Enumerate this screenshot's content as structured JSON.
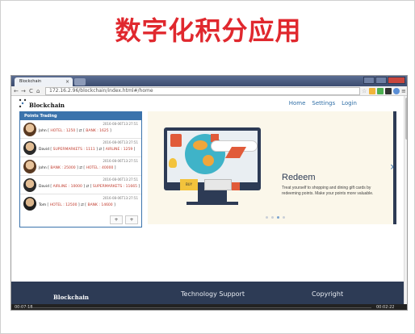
{
  "slide": {
    "title": "数字化积分应用"
  },
  "browser": {
    "tab_title": "Blockchain",
    "tab_close": "×",
    "url": "172.16.2.96/blockchain/index.html#/home",
    "nav": {
      "back": "←",
      "forward": "→",
      "reload": "C",
      "home": "⌂"
    },
    "star": "☆"
  },
  "site": {
    "brand": "Blockchain",
    "nav": [
      "Home",
      "Settings",
      "Login"
    ]
  },
  "points_trading": {
    "title": "Points Trading",
    "trades": [
      {
        "time": "2016-08-06T13:27:51",
        "user": "John",
        "from": "HOTEL : 1250",
        "to": "BANK : 1625"
      },
      {
        "time": "2016-08-06T13:27:51",
        "user": "David",
        "from": "SUPERMARKETS : 1111",
        "to": "AIRLINE : 1259"
      },
      {
        "time": "2016-08-06T13:27:51",
        "user": "John",
        "from": "BANK : 25000",
        "to": "HOTEL : 40000"
      },
      {
        "time": "2016-08-06T13:27:51",
        "user": "David",
        "from": "AIRLINE : 10000",
        "to": "SUPERMARKETS : 11665"
      },
      {
        "time": "2016-08-06T13:27:51",
        "user": "Tom",
        "from": "HOTEL : 12500",
        "to": "BANK : 14600"
      }
    ],
    "pager": [
      "+",
      "+"
    ]
  },
  "carousel": {
    "heading": "Redeem",
    "text": "Treat yourself to shopping and dining gift cards by redeeming points. Make your points more valuable.",
    "buy_label": "BUY",
    "next_arrow": "›",
    "active_slide": 3,
    "slide_count": 4
  },
  "footer": {
    "brand": "Blockchain",
    "columns": [
      "Technology Support",
      "Copyright"
    ]
  },
  "video": {
    "elapsed": "00:07:18",
    "total": "00:02:22"
  },
  "colors": {
    "title_red": "#e0282e",
    "nav_blue": "#2f6ea6",
    "panel_blue": "#3b73ac",
    "footer_navy": "#2d3b55"
  }
}
